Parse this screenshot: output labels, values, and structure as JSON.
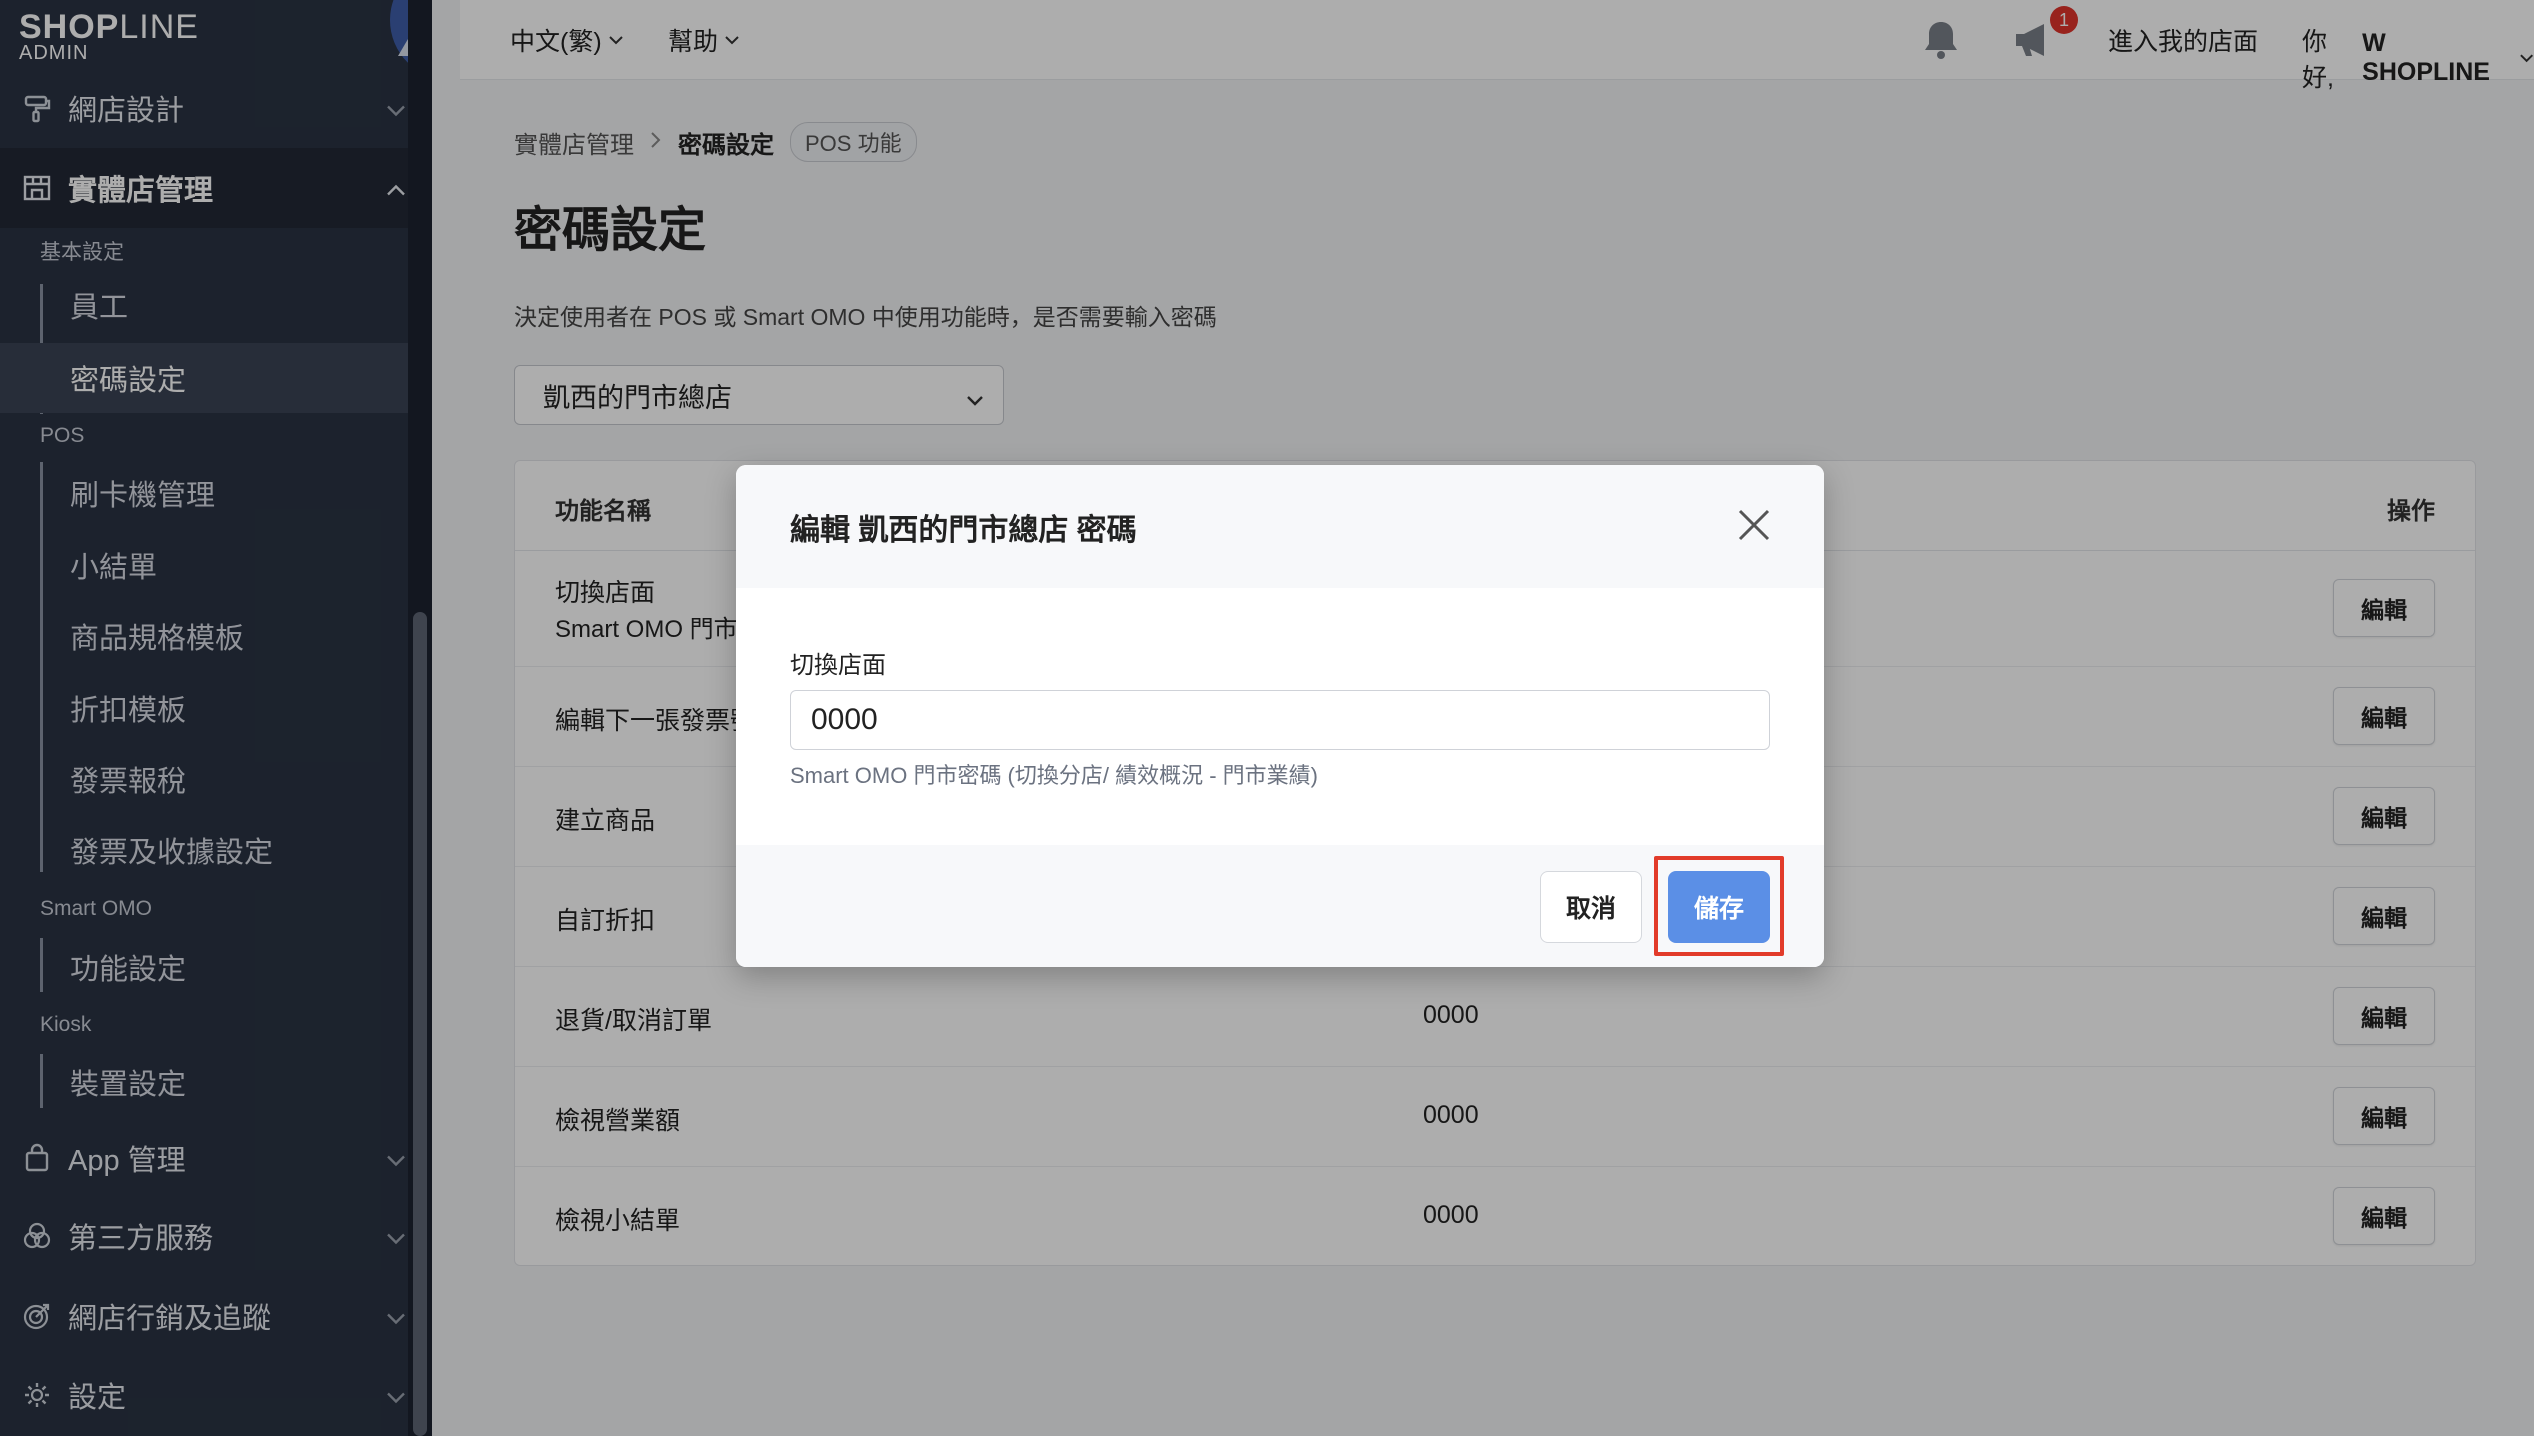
{
  "colors": {
    "sidebar_bg": "#2a3343",
    "accent": "#5b8fe6",
    "highlight": "#e23b2a",
    "badge": "#e0342b"
  },
  "sidebar": {
    "logo": {
      "brand_bold": "SHOP",
      "brand_thin": "LINE",
      "sub": "ADMIN"
    },
    "groups": [
      {
        "label": "網店設計",
        "icon": "paint-roller-icon"
      },
      {
        "label": "實體店管理",
        "icon": "store-icon"
      },
      {
        "label": "App 管理",
        "icon": "bag-icon"
      },
      {
        "label": "第三方服務",
        "icon": "circles-icon"
      },
      {
        "label": "網店行銷及追蹤",
        "icon": "target-icon"
      },
      {
        "label": "設定",
        "icon": "gear-icon"
      }
    ],
    "sections": {
      "basic": "基本設定",
      "pos": "POS",
      "smart_omo": "Smart OMO",
      "kiosk": "Kiosk"
    },
    "items": {
      "staff": "員工",
      "password": "密碼設定",
      "card_reader": "刷卡機管理",
      "receipt": "小結單",
      "product_template": "商品規格模板",
      "discount_template": "折扣模板",
      "invoice_tax": "發票報稅",
      "invoice_settings": "發票及收據設定",
      "feature_settings": "功能設定",
      "device_settings": "裝置設定"
    }
  },
  "topbar": {
    "language": "中文(繁)",
    "help": "幫助",
    "notification_count": "1",
    "enter_store": "進入我的店面",
    "greeting": "你好,",
    "user": "W SHOPLINE"
  },
  "breadcrumb": {
    "parent": "實體店管理",
    "current": "密碼設定",
    "tag": "POS 功能"
  },
  "page": {
    "title": "密碼設定",
    "description": "決定使用者在 POS 或 Smart OMO 中使用功能時，是否需要輸入密碼",
    "store_select": "凱西的門市總店"
  },
  "table": {
    "col_name": "功能名稱",
    "col_action": "操作",
    "edit_label": "編輯",
    "rows": [
      {
        "name": "切換店面",
        "sub": "Smart OMO 門市",
        "password": ""
      },
      {
        "name": "編輯下一張發票號",
        "password": ""
      },
      {
        "name": "建立商品",
        "password": ""
      },
      {
        "name": "自訂折扣",
        "password": ""
      },
      {
        "name": "退貨/取消訂單",
        "password": "0000"
      },
      {
        "name": "檢視營業額",
        "password": "0000"
      },
      {
        "name": "檢視小結單",
        "password": "0000"
      }
    ]
  },
  "modal": {
    "title": "編輯 凱西的門市總店 密碼",
    "field_label": "切換店面",
    "field_value": "0000",
    "hint": "Smart OMO 門市密碼 (切換分店/ 績效概況 - 門市業績)",
    "cancel": "取消",
    "save": "儲存"
  }
}
